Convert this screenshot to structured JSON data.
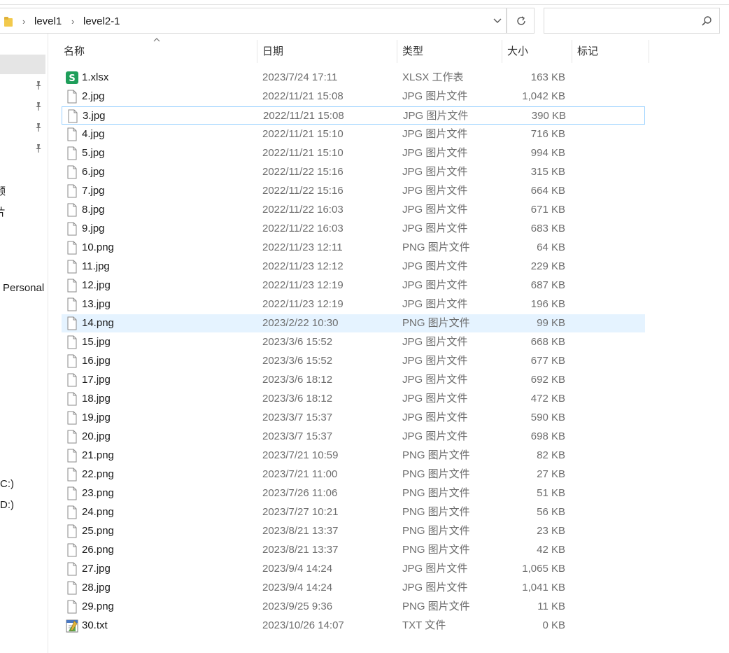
{
  "address": {
    "breadcrumbs": [
      "level1",
      "level2-1"
    ],
    "search_placeholder": ""
  },
  "nav": {
    "items": [
      "频",
      "片",
      "Personal",
      "(C:)",
      "(D:)"
    ]
  },
  "columns": {
    "name": "名称",
    "date": "日期",
    "type": "类型",
    "size": "大小",
    "tag": "标记"
  },
  "files": [
    {
      "name": "1.xlsx",
      "date": "2023/7/24 17:11",
      "type": "XLSX 工作表",
      "size": "163 KB",
      "icon": "xlsx-file-icon"
    },
    {
      "name": "2.jpg",
      "date": "2022/11/21 15:08",
      "type": "JPG 图片文件",
      "size": "1,042 KB",
      "icon": "file-icon"
    },
    {
      "name": "3.jpg",
      "date": "2022/11/21 15:08",
      "type": "JPG 图片文件",
      "size": "390 KB",
      "icon": "file-icon"
    },
    {
      "name": "4.jpg",
      "date": "2022/11/21 15:10",
      "type": "JPG 图片文件",
      "size": "716 KB",
      "icon": "file-icon"
    },
    {
      "name": "5.jpg",
      "date": "2022/11/21 15:10",
      "type": "JPG 图片文件",
      "size": "994 KB",
      "icon": "file-icon"
    },
    {
      "name": "6.jpg",
      "date": "2022/11/22 15:16",
      "type": "JPG 图片文件",
      "size": "315 KB",
      "icon": "file-icon"
    },
    {
      "name": "7.jpg",
      "date": "2022/11/22 15:16",
      "type": "JPG 图片文件",
      "size": "664 KB",
      "icon": "file-icon"
    },
    {
      "name": "8.jpg",
      "date": "2022/11/22 16:03",
      "type": "JPG 图片文件",
      "size": "671 KB",
      "icon": "file-icon"
    },
    {
      "name": "9.jpg",
      "date": "2022/11/22 16:03",
      "type": "JPG 图片文件",
      "size": "683 KB",
      "icon": "file-icon"
    },
    {
      "name": "10.png",
      "date": "2022/11/23 12:11",
      "type": "PNG 图片文件",
      "size": "64 KB",
      "icon": "file-icon"
    },
    {
      "name": "11.jpg",
      "date": "2022/11/23 12:12",
      "type": "JPG 图片文件",
      "size": "229 KB",
      "icon": "file-icon"
    },
    {
      "name": "12.jpg",
      "date": "2022/11/23 12:19",
      "type": "JPG 图片文件",
      "size": "687 KB",
      "icon": "file-icon"
    },
    {
      "name": "13.jpg",
      "date": "2022/11/23 12:19",
      "type": "JPG 图片文件",
      "size": "196 KB",
      "icon": "file-icon"
    },
    {
      "name": "14.png",
      "date": "2023/2/22 10:30",
      "type": "PNG 图片文件",
      "size": "99 KB",
      "icon": "file-icon"
    },
    {
      "name": "15.jpg",
      "date": "2023/3/6 15:52",
      "type": "JPG 图片文件",
      "size": "668 KB",
      "icon": "file-icon"
    },
    {
      "name": "16.jpg",
      "date": "2023/3/6 15:52",
      "type": "JPG 图片文件",
      "size": "677 KB",
      "icon": "file-icon"
    },
    {
      "name": "17.jpg",
      "date": "2023/3/6 18:12",
      "type": "JPG 图片文件",
      "size": "692 KB",
      "icon": "file-icon"
    },
    {
      "name": "18.jpg",
      "date": "2023/3/6 18:12",
      "type": "JPG 图片文件",
      "size": "472 KB",
      "icon": "file-icon"
    },
    {
      "name": "19.jpg",
      "date": "2023/3/7 15:37",
      "type": "JPG 图片文件",
      "size": "590 KB",
      "icon": "file-icon"
    },
    {
      "name": "20.jpg",
      "date": "2023/3/7 15:37",
      "type": "JPG 图片文件",
      "size": "698 KB",
      "icon": "file-icon"
    },
    {
      "name": "21.png",
      "date": "2023/7/21 10:59",
      "type": "PNG 图片文件",
      "size": "82 KB",
      "icon": "file-icon"
    },
    {
      "name": "22.png",
      "date": "2023/7/21 11:00",
      "type": "PNG 图片文件",
      "size": "27 KB",
      "icon": "file-icon"
    },
    {
      "name": "23.png",
      "date": "2023/7/26 11:06",
      "type": "PNG 图片文件",
      "size": "51 KB",
      "icon": "file-icon"
    },
    {
      "name": "24.png",
      "date": "2023/7/27 10:21",
      "type": "PNG 图片文件",
      "size": "56 KB",
      "icon": "file-icon"
    },
    {
      "name": "25.png",
      "date": "2023/8/21 13:37",
      "type": "PNG 图片文件",
      "size": "23 KB",
      "icon": "file-icon"
    },
    {
      "name": "26.png",
      "date": "2023/8/21 13:37",
      "type": "PNG 图片文件",
      "size": "42 KB",
      "icon": "file-icon"
    },
    {
      "name": "27.jpg",
      "date": "2023/9/4 14:24",
      "type": "JPG 图片文件",
      "size": "1,065 KB",
      "icon": "file-icon"
    },
    {
      "name": "28.jpg",
      "date": "2023/9/4 14:24",
      "type": "JPG 图片文件",
      "size": "1,041 KB",
      "icon": "file-icon"
    },
    {
      "name": "29.png",
      "date": "2023/9/25 9:36",
      "type": "PNG 图片文件",
      "size": "11 KB",
      "icon": "file-icon"
    },
    {
      "name": "30.txt",
      "date": "2023/10/26 14:07",
      "type": "TXT 文件",
      "size": "0 KB",
      "icon": "txt-file-icon"
    }
  ],
  "state": {
    "focused_row": 2,
    "hovered_row": 13
  },
  "colors": {
    "hover": "#e5f3ff",
    "focus_border": "#99d1ff",
    "xlsx_green": "#1e9e5a",
    "folder_yellow": "#f2c94c"
  }
}
